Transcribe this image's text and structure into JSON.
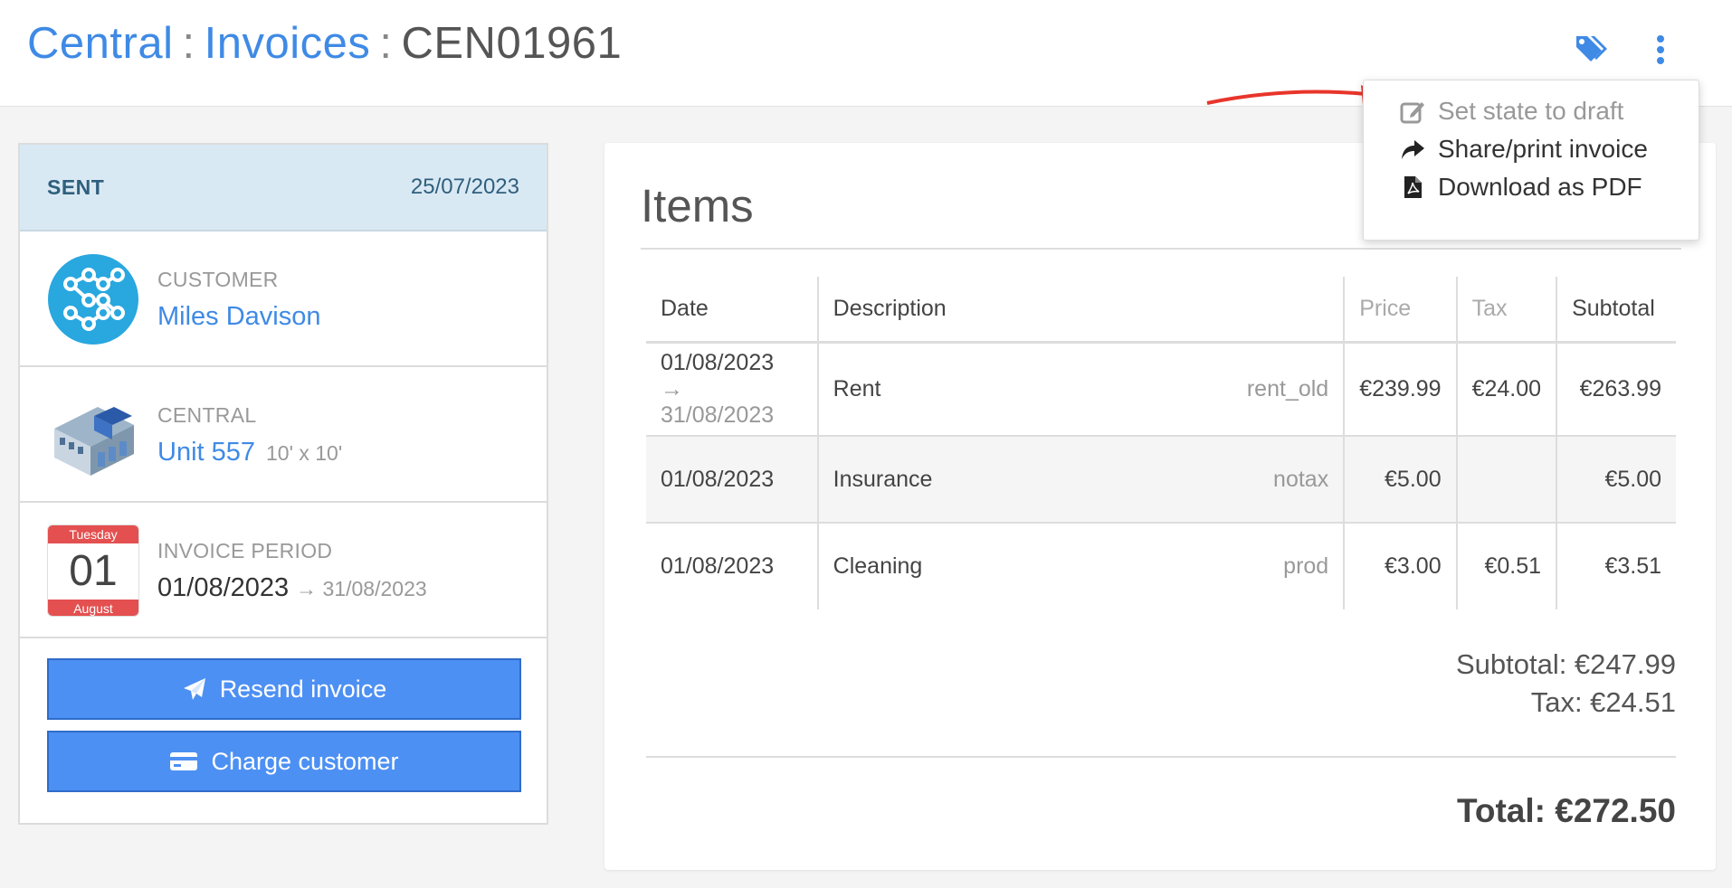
{
  "header": {
    "breadcrumb": [
      "Central",
      "Invoices",
      "CEN01961"
    ],
    "separator": ":"
  },
  "status": {
    "label": "SENT",
    "date": "25/07/2023"
  },
  "customer": {
    "kicker": "CUSTOMER",
    "name": "Miles Davison"
  },
  "location": {
    "kicker": "CENTRAL",
    "unit": "Unit 557",
    "size": "10' x 10'"
  },
  "period": {
    "kicker": "INVOICE PERIOD",
    "start": "01/08/2023",
    "end": "→ 31/08/2023",
    "calendar": {
      "weekday": "Tuesday",
      "day": "01",
      "month": "August"
    }
  },
  "actions": {
    "resend": "Resend invoice",
    "charge": "Charge customer"
  },
  "items": {
    "title": "Items",
    "columns": [
      "Date",
      "Description",
      "Price",
      "Tax",
      "Subtotal"
    ],
    "rows": [
      {
        "date": "01/08/2023",
        "date_end": "→ 31/08/2023",
        "description": "Rent",
        "code": "rent_old",
        "price": "€239.99",
        "tax": "€24.00",
        "subtotal": "€263.99"
      },
      {
        "date": "01/08/2023",
        "date_end": "",
        "description": "Insurance",
        "code": "notax",
        "price": "€5.00",
        "tax": "",
        "subtotal": "€5.00"
      },
      {
        "date": "01/08/2023",
        "date_end": "",
        "description": "Cleaning",
        "code": "prod",
        "price": "€3.00",
        "tax": "€0.51",
        "subtotal": "€3.51"
      }
    ],
    "subtotal": "Subtotal: €247.99",
    "tax": "Tax: €24.51",
    "total": "Total: €272.50"
  },
  "menu": {
    "items": [
      {
        "label": "Set state to draft",
        "icon": "edit-icon",
        "disabled": true
      },
      {
        "label": "Share/print invoice",
        "icon": "share-icon",
        "disabled": false
      },
      {
        "label": "Download as PDF",
        "icon": "pdf-icon",
        "disabled": false
      }
    ]
  },
  "colors": {
    "accent": "#3f8ae5",
    "button": "#4d90f3",
    "status_bg": "#d9e9f4",
    "annotation": "#e8352b"
  }
}
